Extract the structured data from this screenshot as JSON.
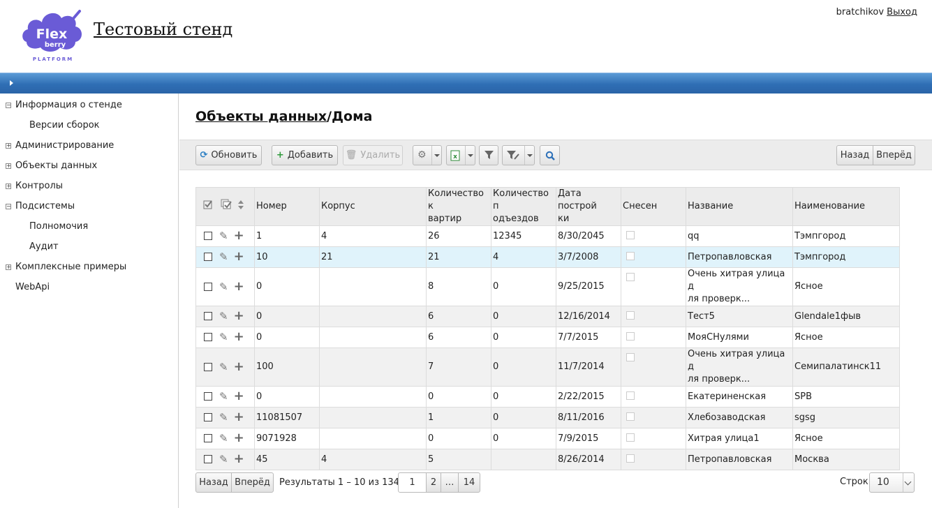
{
  "header": {
    "logo_text": "Flex",
    "logo_sub": "berry",
    "logo_platform": "PLATFORM",
    "site_title": "Тестовый стенд",
    "username": "bratchikov",
    "logout_label": "Выход"
  },
  "sidebar": {
    "items": [
      {
        "label": "Информация о стенде",
        "toggle": "−"
      },
      {
        "label": "Версии сборок"
      },
      {
        "label": "Администрирование",
        "toggle": "+"
      },
      {
        "label": "Объекты данных",
        "toggle": "+"
      },
      {
        "label": "Контролы",
        "toggle": "+"
      },
      {
        "label": "Подсистемы",
        "toggle": "−"
      },
      {
        "label": "Полномочия"
      },
      {
        "label": "Аудит"
      },
      {
        "label": "Комплексные примеры",
        "toggle": "+"
      },
      {
        "label": "WebApi"
      }
    ]
  },
  "breadcrumb": {
    "parent": "Объекты данных",
    "separator": "/",
    "current": "Дома"
  },
  "toolbar": {
    "refresh_label": "Обновить",
    "add_label": "Добавить",
    "delete_label": "Удалить",
    "back_label": "Назад",
    "forward_label": "Вперёд"
  },
  "table": {
    "columns": [
      "Номер",
      "Корпус",
      "Количество квартир",
      "Количество подъездов",
      "Дата постройки",
      "Снесен",
      "Название",
      "Наименование"
    ],
    "column_display": [
      "Номер",
      "Корпус",
      "Количество к\nвартир",
      "Количество п\nодъездов",
      "Дата построй\nки",
      "Снесен",
      "Название",
      "Наименование"
    ],
    "rows": [
      [
        "1",
        "4",
        "26",
        "12345",
        "8/30/2045",
        "",
        "qq",
        "Тэмпгород"
      ],
      [
        "10",
        "21",
        "21",
        "4",
        "3/7/2008",
        "",
        "Петропавловская",
        "Тэмпгород"
      ],
      [
        "0",
        "",
        "8",
        "0",
        "9/25/2015",
        "",
        "Очень хитрая улица для проверк...",
        "Ясное"
      ],
      [
        "0",
        "",
        "6",
        "0",
        "12/16/2014",
        "",
        "Тест5",
        "Glendale1фыв"
      ],
      [
        "0",
        "",
        "6",
        "0",
        "7/7/2015",
        "",
        "МояСНулями",
        "Ясное"
      ],
      [
        "100",
        "",
        "7",
        "0",
        "11/7/2014",
        "",
        "Очень хитрая улица для проверк...",
        "Семипалатинск11"
      ],
      [
        "0",
        "",
        "0",
        "0",
        "2/22/2015",
        "",
        "Екатериненская",
        "SPB"
      ],
      [
        "11081507",
        "",
        "1",
        "0",
        "8/11/2016",
        "",
        "Хлебозаводская",
        "sgsg"
      ],
      [
        "9071928",
        "",
        "0",
        "0",
        "7/9/2015",
        "",
        "Хитрая улица1",
        "Ясное"
      ],
      [
        "45",
        "4",
        "5",
        "",
        "8/26/2014",
        "",
        "Петропавловская",
        "Москва"
      ]
    ],
    "name_display": [
      "qq",
      "Петропавловская",
      "Очень хитрая улица д\nля проверк...",
      "Тест5",
      "МояСНулями",
      "Очень хитрая улица д\nля проверк...",
      "Екатериненская",
      "Хлебозаводская",
      "Хитрая улица1",
      "Петропавловская"
    ],
    "selected_row": 1
  },
  "pager": {
    "back_label": "Назад",
    "forward_label": "Вперёд",
    "results_text": "Результаты 1 – 10 из 134",
    "pages": [
      "1",
      "2",
      "…",
      "14"
    ],
    "current_page": "1",
    "rows_label": "Строк:",
    "rows_value": "10"
  },
  "colors": {
    "topbar": "#2f6eb4",
    "selected_row": "#e0f3fb",
    "logo": "#6a5bd6",
    "add_icon": "#2e9a3a",
    "refresh_icon": "#2b7fc3",
    "search_icon": "#2b6fb8"
  }
}
